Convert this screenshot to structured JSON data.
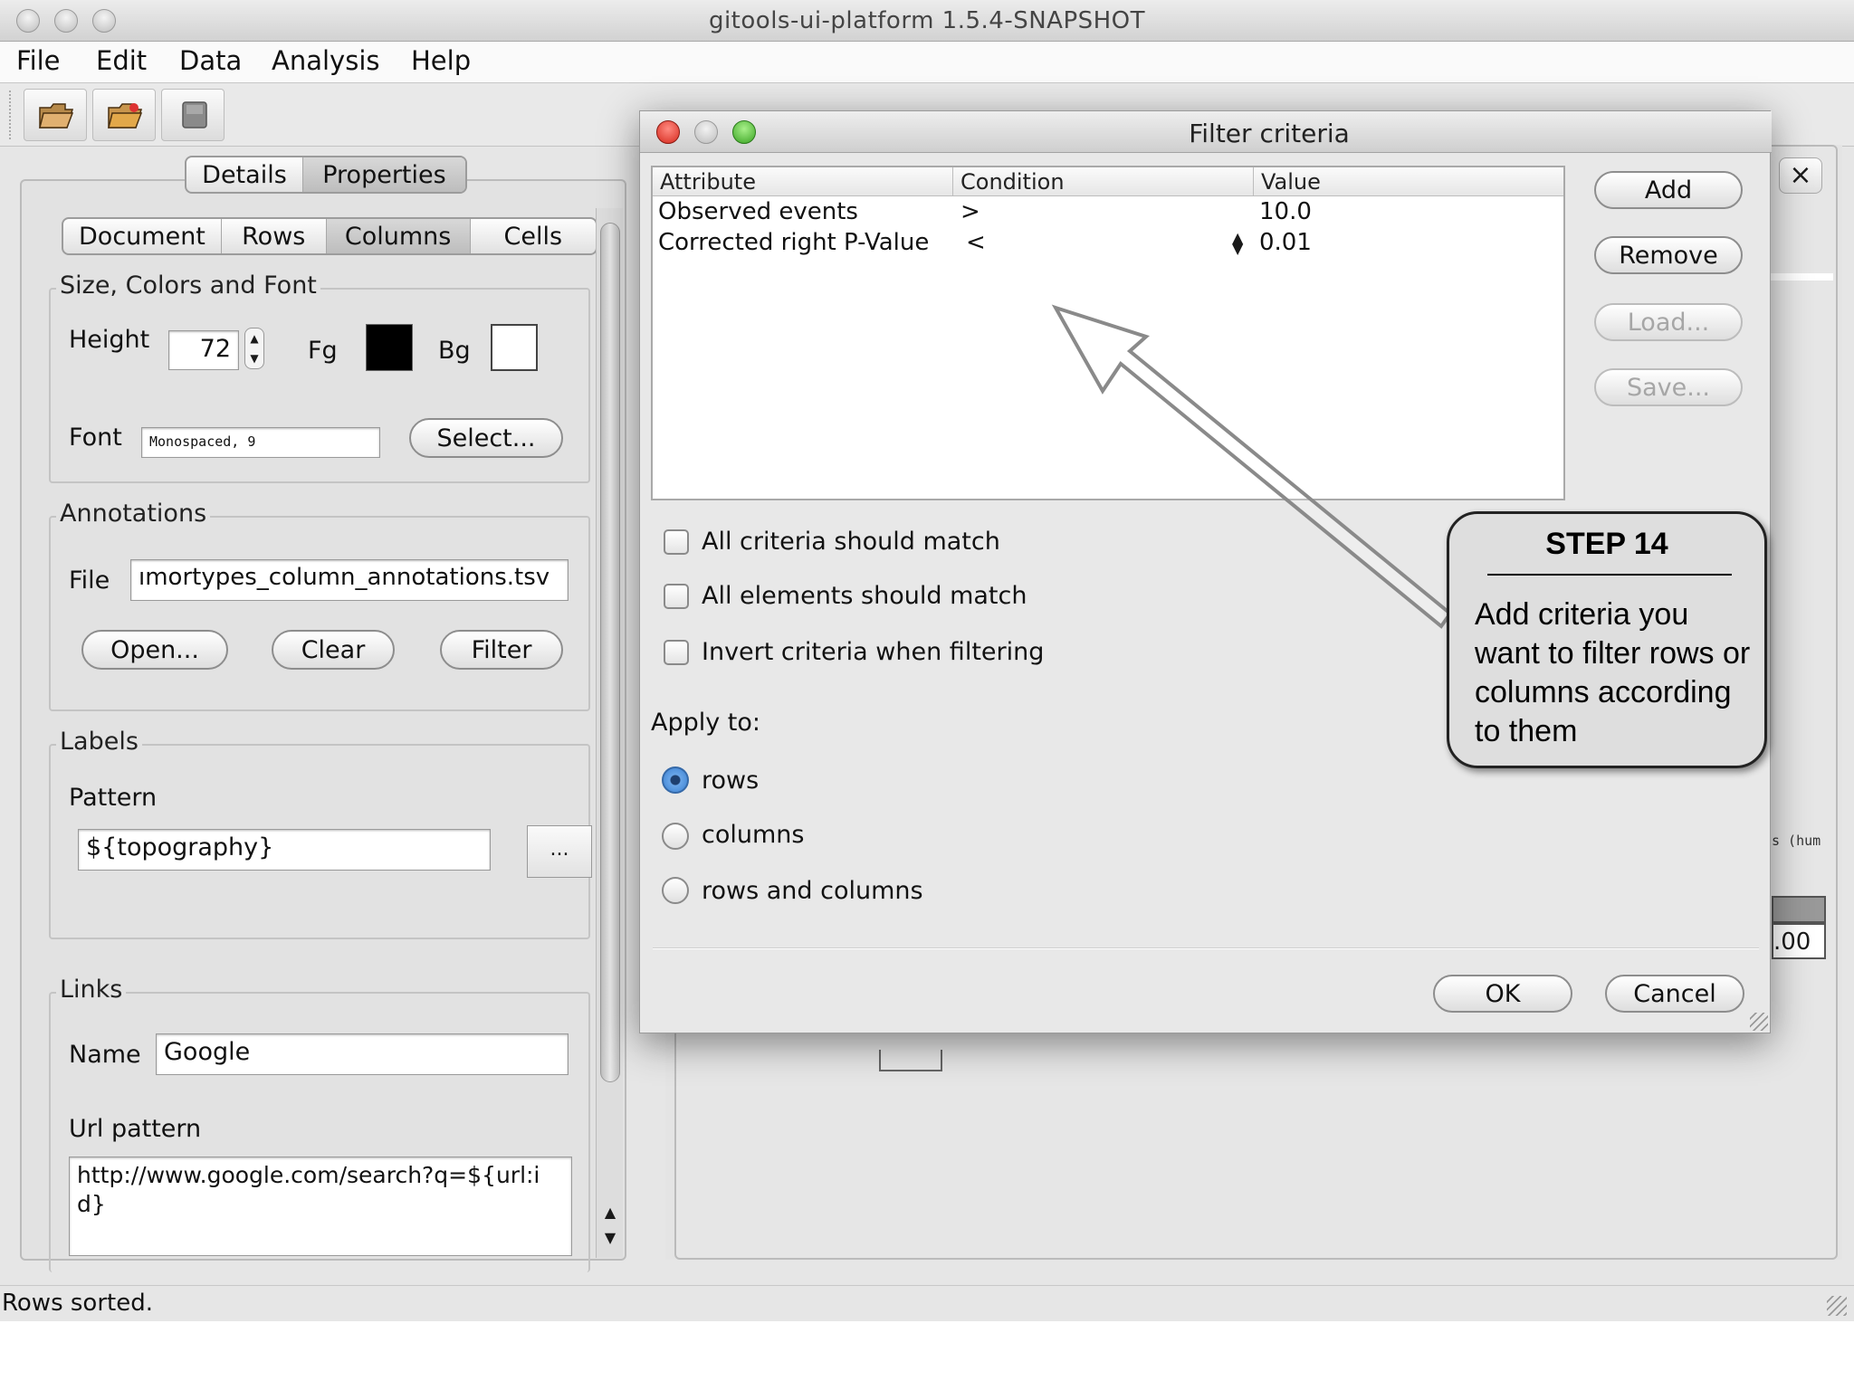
{
  "window": {
    "title": "gitools-ui-platform 1.5.4-SNAPSHOT",
    "status": "Rows sorted."
  },
  "menubar": [
    "File",
    "Edit",
    "Data",
    "Analysis",
    "Help"
  ],
  "left_panel": {
    "top_tabs": [
      "Details",
      "Properties"
    ],
    "top_tab_selected": "Properties",
    "sub_tabs": [
      "Document",
      "Rows",
      "Columns",
      "Cells"
    ],
    "sub_tab_selected": "Columns",
    "size_group": {
      "title": "Size, Colors and Font",
      "height_label": "Height",
      "height_value": "72",
      "fg_label": "Fg",
      "fg_color": "#000000",
      "bg_label": "Bg",
      "bg_color": "#ffffff",
      "font_label": "Font",
      "font_value": "Monospaced, 9",
      "select_button": "Select..."
    },
    "annotations_group": {
      "title": "Annotations",
      "file_label": "File",
      "file_value": "ımortypes_column_annotations.tsv",
      "open_button": "Open...",
      "clear_button": "Clear",
      "filter_button": "Filter"
    },
    "labels_group": {
      "title": "Labels",
      "pattern_label": "Pattern",
      "pattern_value": "${topography}",
      "browse_button": "..."
    },
    "links_group": {
      "title": "Links",
      "name_label": "Name",
      "name_value": "Google",
      "url_label": "Url pattern",
      "url_value": "http://www.google.com/search?q=${url:id}"
    }
  },
  "background": {
    "close_label": "×",
    "fragment_text_1": "s (hum",
    "fragment_text_2": ".00"
  },
  "dialog": {
    "title": "Filter criteria",
    "columns": [
      "Attribute",
      "Condition",
      "Value"
    ],
    "rows": [
      {
        "attribute": "Observed events",
        "condition": ">",
        "value": "10.0"
      },
      {
        "attribute": "Corrected right P-Value",
        "condition": "<",
        "value": "0.01"
      }
    ],
    "buttons": {
      "add": "Add",
      "remove": "Remove",
      "load": "Load...",
      "save": "Save..."
    },
    "checkboxes": [
      {
        "label": "All criteria should match",
        "checked": false
      },
      {
        "label": "All elements should match",
        "checked": false
      },
      {
        "label": "Invert criteria when filtering",
        "checked": false
      }
    ],
    "apply_to_label": "Apply to:",
    "apply_options": [
      {
        "label": "rows",
        "selected": true
      },
      {
        "label": "columns",
        "selected": false
      },
      {
        "label": "rows and columns",
        "selected": false
      }
    ],
    "ok_button": "OK",
    "cancel_button": "Cancel"
  },
  "callout": {
    "heading": "STEP 14",
    "body": "Add criteria you want to filter rows or columns according to them"
  }
}
